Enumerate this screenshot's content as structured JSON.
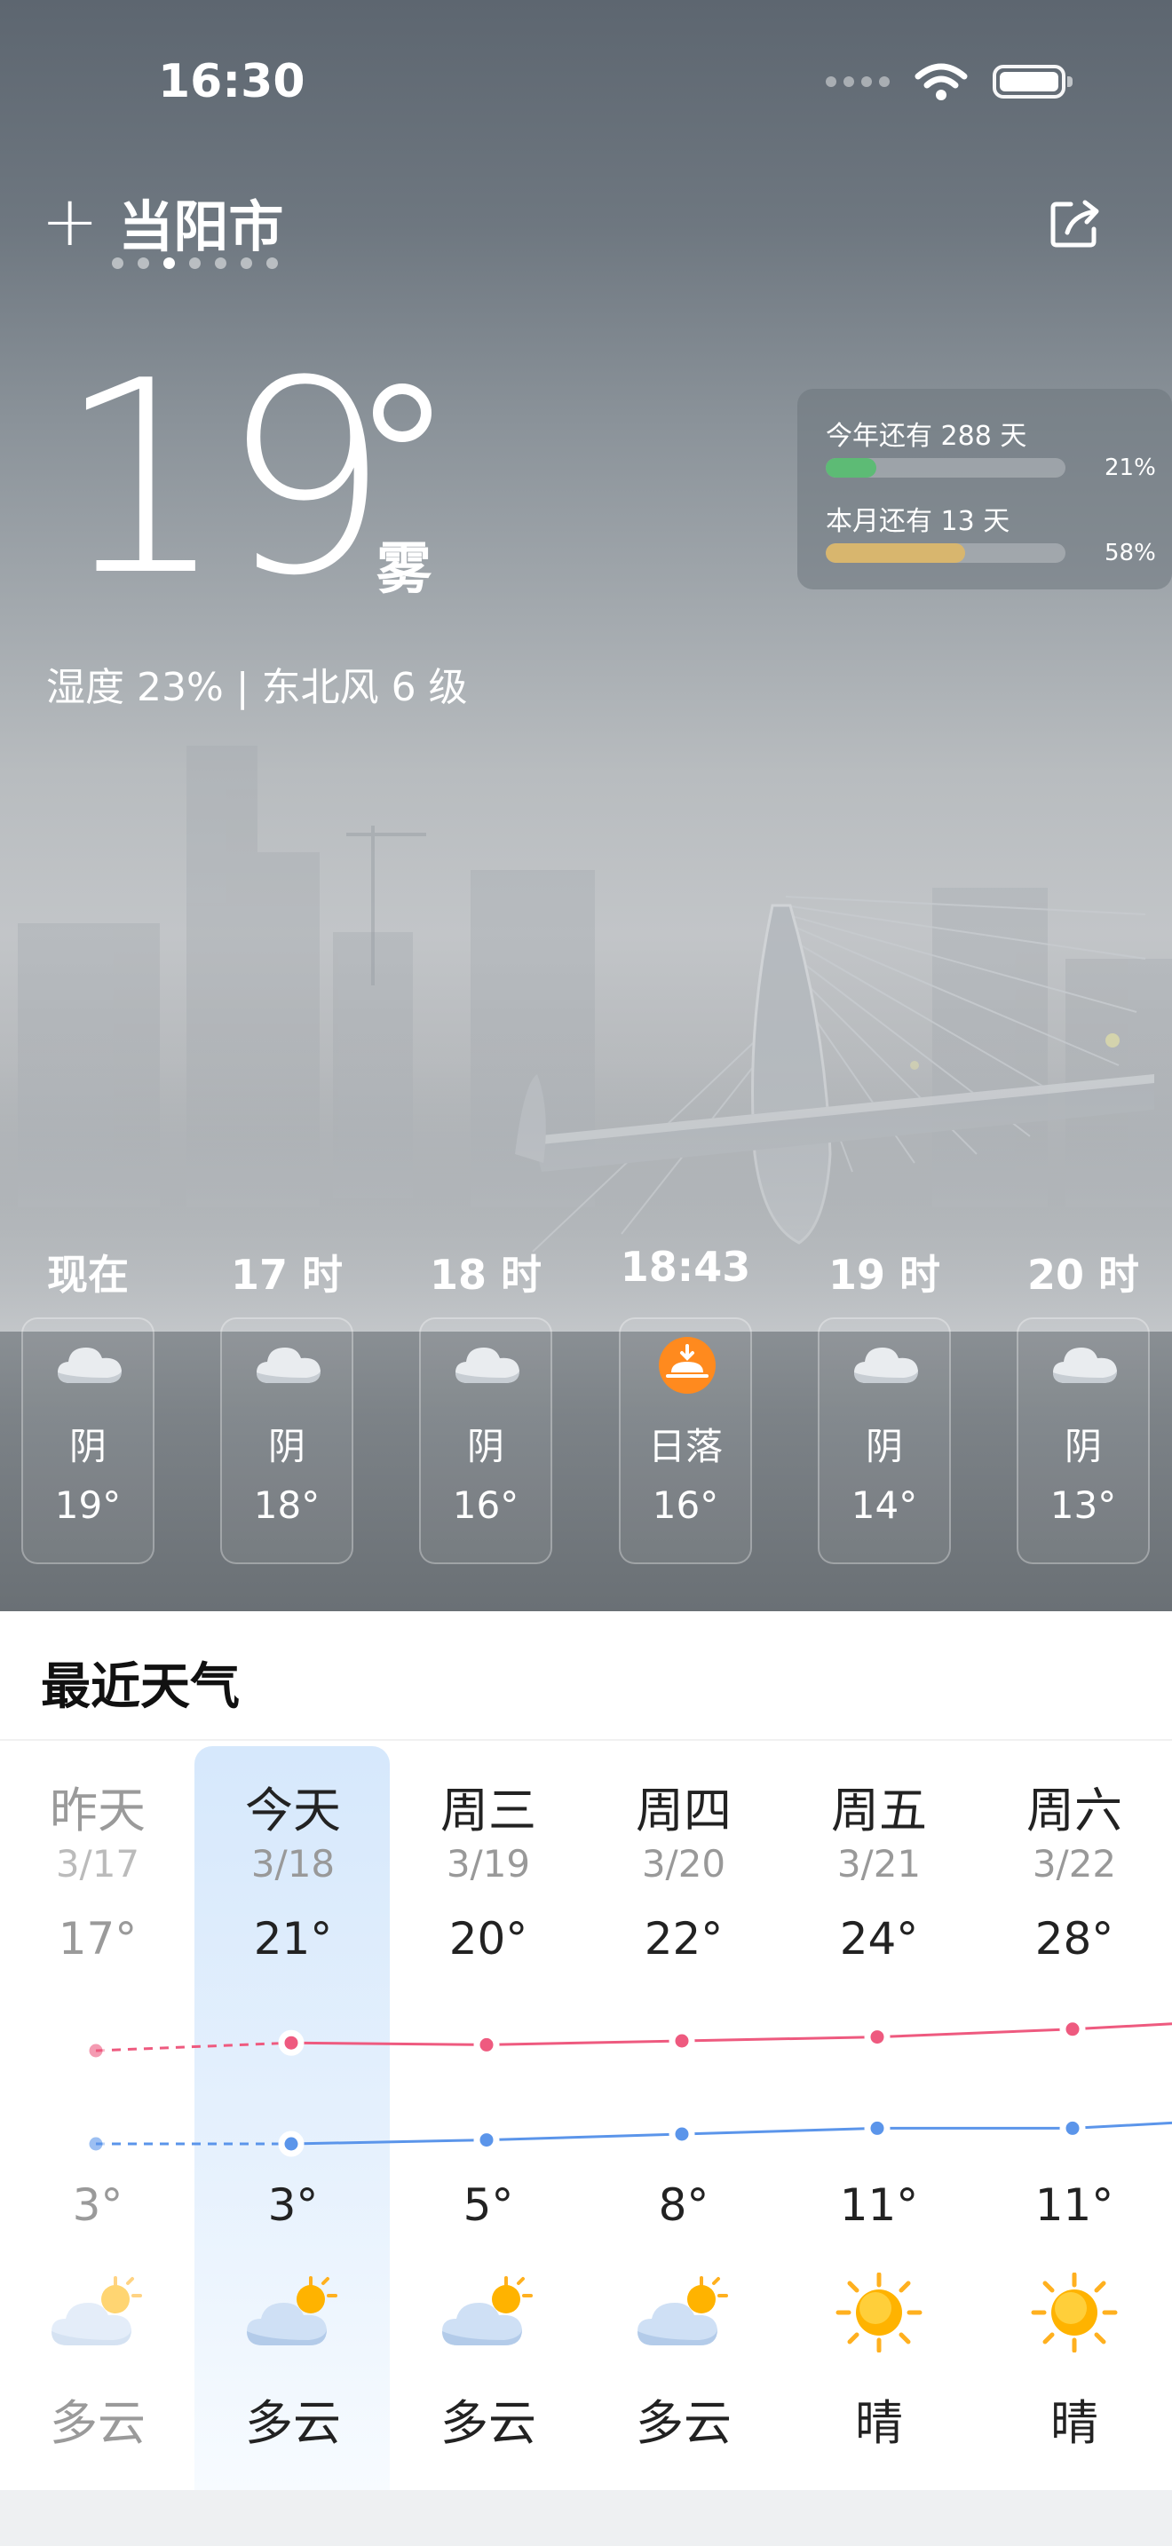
{
  "status_bar": {
    "time": "16:30"
  },
  "header": {
    "city": "当阳市",
    "add_icon": "plus-icon",
    "share_icon": "share-icon",
    "page_dots": 7,
    "active_dot": 2
  },
  "current": {
    "temperature": "19",
    "condition": "雾",
    "details": "湿度 23% | 东北风 6 级"
  },
  "progress": [
    {
      "label": "今年还有 288 天",
      "percent_text": "21%",
      "fraction": 0.21,
      "color": "#5dbb75"
    },
    {
      "label": "本月还有 13 天",
      "percent_text": "58%",
      "fraction": 0.58,
      "color": "#d8b66e"
    }
  ],
  "hourly": [
    {
      "time": "现在",
      "icon": "cloud-icon",
      "condition": "阴",
      "temp": "19°"
    },
    {
      "time": "17 时",
      "icon": "cloud-icon",
      "condition": "阴",
      "temp": "18°"
    },
    {
      "time": "18 时",
      "icon": "cloud-icon",
      "condition": "阴",
      "temp": "16°"
    },
    {
      "time": "18:43",
      "icon": "sunset-icon",
      "condition": "日落",
      "temp": "16°"
    },
    {
      "time": "19 时",
      "icon": "cloud-icon",
      "condition": "阴",
      "temp": "14°"
    },
    {
      "time": "20 时",
      "icon": "cloud-icon",
      "condition": "阴",
      "temp": "13°"
    }
  ],
  "forecast": {
    "title": "最近天气",
    "days": [
      {
        "name": "昨天",
        "date": "3/17",
        "high": "17°",
        "low": "3°",
        "icon": "partly-cloudy-icon",
        "condition": "多云",
        "past": true
      },
      {
        "name": "今天",
        "date": "3/18",
        "high": "21°",
        "low": "3°",
        "icon": "partly-cloudy-icon",
        "condition": "多云",
        "today": true
      },
      {
        "name": "周三",
        "date": "3/19",
        "high": "20°",
        "low": "5°",
        "icon": "partly-cloudy-icon",
        "condition": "多云"
      },
      {
        "name": "周四",
        "date": "3/20",
        "high": "22°",
        "low": "8°",
        "icon": "partly-cloudy-icon",
        "condition": "多云"
      },
      {
        "name": "周五",
        "date": "3/21",
        "high": "24°",
        "low": "11°",
        "icon": "sun-icon",
        "condition": "晴"
      },
      {
        "name": "周六",
        "date": "3/22",
        "high": "28°",
        "low": "11°",
        "icon": "sun-icon",
        "condition": "晴"
      }
    ]
  },
  "colors": {
    "high_line": "#ee5a7f",
    "low_line": "#5b95ea"
  }
}
